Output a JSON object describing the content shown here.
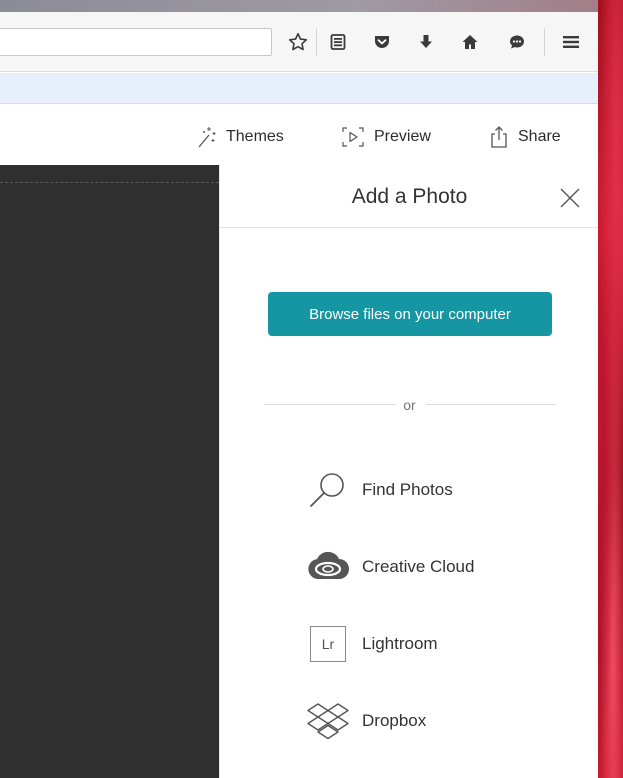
{
  "browser": {
    "toolbar_icons": [
      "star-icon",
      "reading-list-icon",
      "pocket-icon",
      "download-icon",
      "home-icon",
      "chat-icon",
      "menu-icon"
    ]
  },
  "app": {
    "themes_label": "Themes",
    "preview_label": "Preview",
    "share_label": "Share"
  },
  "panel": {
    "title": "Add a Photo",
    "browse_label": "Browse files on your computer",
    "or_label": "or",
    "sources": [
      {
        "label": "Find Photos",
        "icon": "search-icon"
      },
      {
        "label": "Creative Cloud",
        "icon": "creative-cloud-icon"
      },
      {
        "label": "Lightroom",
        "icon": "lightroom-icon",
        "icon_text": "Lr"
      },
      {
        "label": "Dropbox",
        "icon": "dropbox-icon"
      }
    ]
  },
  "colors": {
    "accent": "#1696a3",
    "canvas": "#2f2f2f",
    "bookmarks_bar": "#e6effb"
  }
}
